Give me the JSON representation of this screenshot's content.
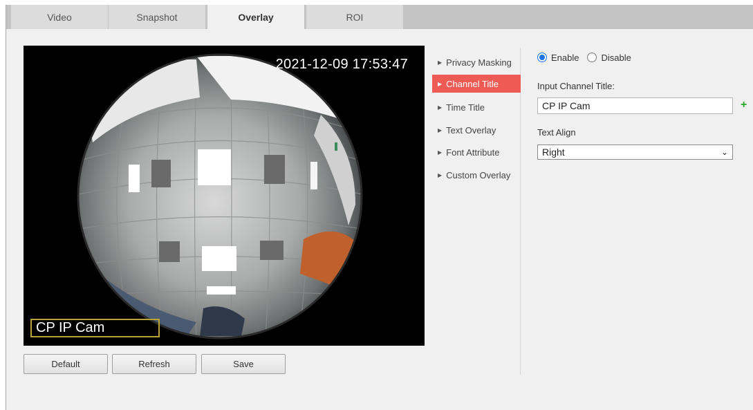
{
  "tabs": [
    {
      "label": "Video"
    },
    {
      "label": "Snapshot"
    },
    {
      "label": "Overlay"
    },
    {
      "label": "ROI"
    }
  ],
  "video": {
    "timestamp": "2021-12-09 17:53:47",
    "channel_title_osd": "CP IP Cam"
  },
  "buttons": {
    "default": "Default",
    "refresh": "Refresh",
    "save": "Save"
  },
  "menu": [
    {
      "label": "Privacy Masking"
    },
    {
      "label": "Channel Title"
    },
    {
      "label": "Time Title"
    },
    {
      "label": "Text Overlay"
    },
    {
      "label": "Font Attribute"
    },
    {
      "label": "Custom Overlay"
    }
  ],
  "panel": {
    "enable_label": "Enable",
    "disable_label": "Disable",
    "input_title_label": "Input Channel Title:",
    "channel_title_value": "CP IP Cam",
    "text_align_label": "Text Align",
    "text_align_value": "Right"
  },
  "colors": {
    "active_menu": "#ee5a54",
    "osd_border": "#b8a432",
    "radio_accent": "#1a73e8",
    "plus_icon": "#29a329"
  }
}
